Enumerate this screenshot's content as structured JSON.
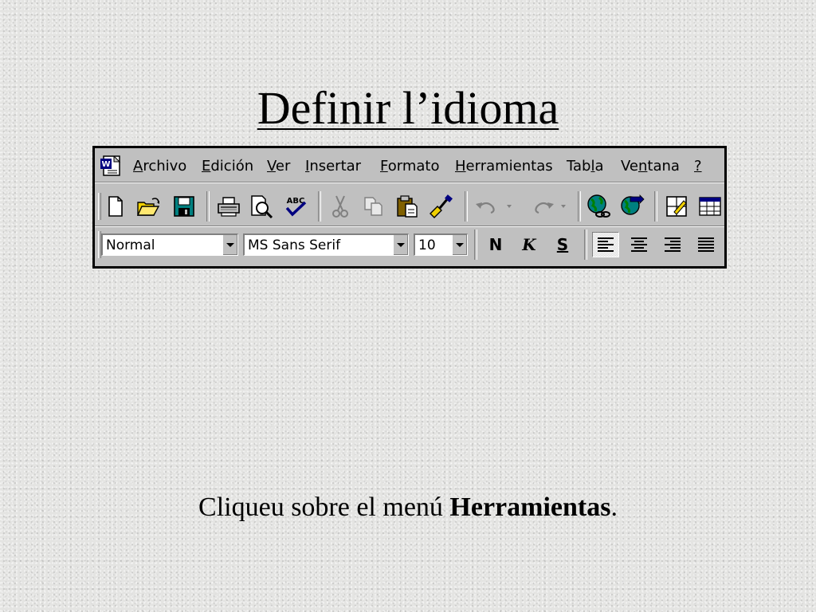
{
  "slide": {
    "title": "Definir l’idioma",
    "instruction_prefix": "Cliqueu sobre el menú ",
    "instruction_bold": "Herramientas",
    "instruction_suffix": "."
  },
  "menubar": {
    "items": [
      {
        "acc": "A",
        "rest": "rchivo"
      },
      {
        "acc": "E",
        "rest": "dición"
      },
      {
        "acc": "V",
        "rest": "er"
      },
      {
        "acc": "I",
        "rest": "nsertar"
      },
      {
        "acc": "F",
        "rest": "ormato"
      },
      {
        "acc": "H",
        "rest": "erramientas"
      },
      {
        "pre": "Tab",
        "acc": "l",
        "rest": "a"
      },
      {
        "pre": "Ve",
        "acc": "n",
        "rest": "tana"
      },
      {
        "acc": "?",
        "rest": ""
      }
    ]
  },
  "standard_toolbar": {
    "icons": [
      "new-document-icon",
      "open-folder-icon",
      "save-disk-icon",
      "print-icon",
      "print-preview-icon",
      "spelling-icon",
      "cut-icon",
      "copy-icon",
      "paste-icon",
      "format-painter-icon",
      "undo-icon",
      "redo-icon",
      "insert-hyperlink-icon",
      "web-toolbar-icon",
      "tables-and-borders-icon",
      "insert-table-icon"
    ],
    "spelling_glyph": "ABC"
  },
  "formatting_toolbar": {
    "style_value": "Normal",
    "font_value": "MS Sans Serif",
    "size_value": "10",
    "bold_label": "N",
    "italic_label": "K",
    "underline_label": "S",
    "alignment_selected": "left"
  },
  "colors": {
    "window_bg": "#c0c0c0",
    "border": "#000000",
    "icon_yellow": "#f0d000",
    "icon_navy": "#000080",
    "icon_teal": "#008080"
  }
}
